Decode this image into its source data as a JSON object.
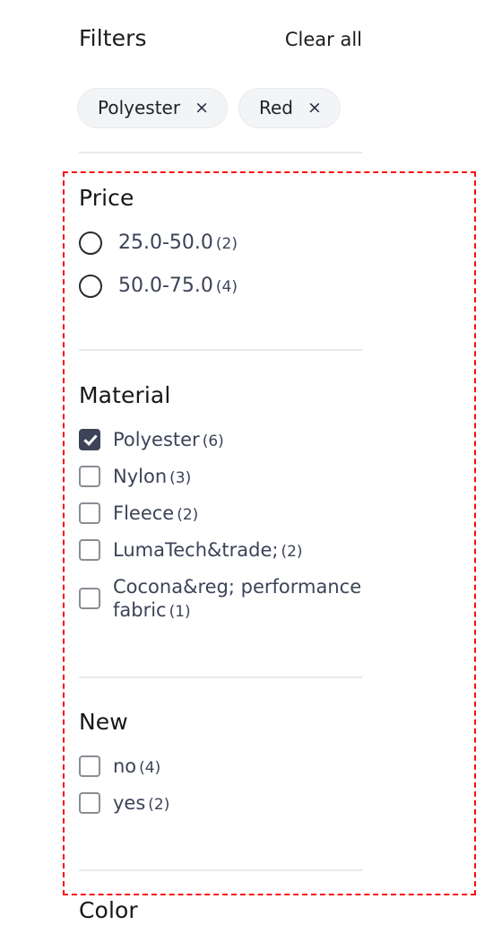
{
  "header": {
    "title": "Filters",
    "clear_all_label": "Clear all"
  },
  "applied_filters": [
    {
      "label": "Polyester",
      "remove_icon": "close-icon",
      "remove_glyph": "×"
    },
    {
      "label": "Red",
      "remove_icon": "close-icon",
      "remove_glyph": "×"
    }
  ],
  "sections": {
    "price": {
      "title": "Price",
      "control": "radio",
      "options": [
        {
          "label": "25.0-50.0",
          "count": "(2)",
          "checked": false
        },
        {
          "label": "50.0-75.0",
          "count": "(4)",
          "checked": false
        }
      ]
    },
    "material": {
      "title": "Material",
      "control": "checkbox",
      "options": [
        {
          "label": "Polyester",
          "count": "(6)",
          "checked": true
        },
        {
          "label": "Nylon",
          "count": "(3)",
          "checked": false
        },
        {
          "label": "Fleece",
          "count": "(2)",
          "checked": false
        },
        {
          "label": "LumaTech&trade;",
          "count": "(2)",
          "checked": false
        },
        {
          "label": "Cocona&reg; performance fabric",
          "count": "(1)",
          "checked": false
        }
      ]
    },
    "newness": {
      "title": "New",
      "control": "checkbox",
      "options": [
        {
          "label": "no",
          "count": "(4)",
          "checked": false
        },
        {
          "label": "yes",
          "count": "(2)",
          "checked": false
        }
      ]
    },
    "color": {
      "title": "Color"
    }
  },
  "annotation": {
    "highlight_color": "#fb0d0d",
    "style": "dashed-rectangle"
  }
}
